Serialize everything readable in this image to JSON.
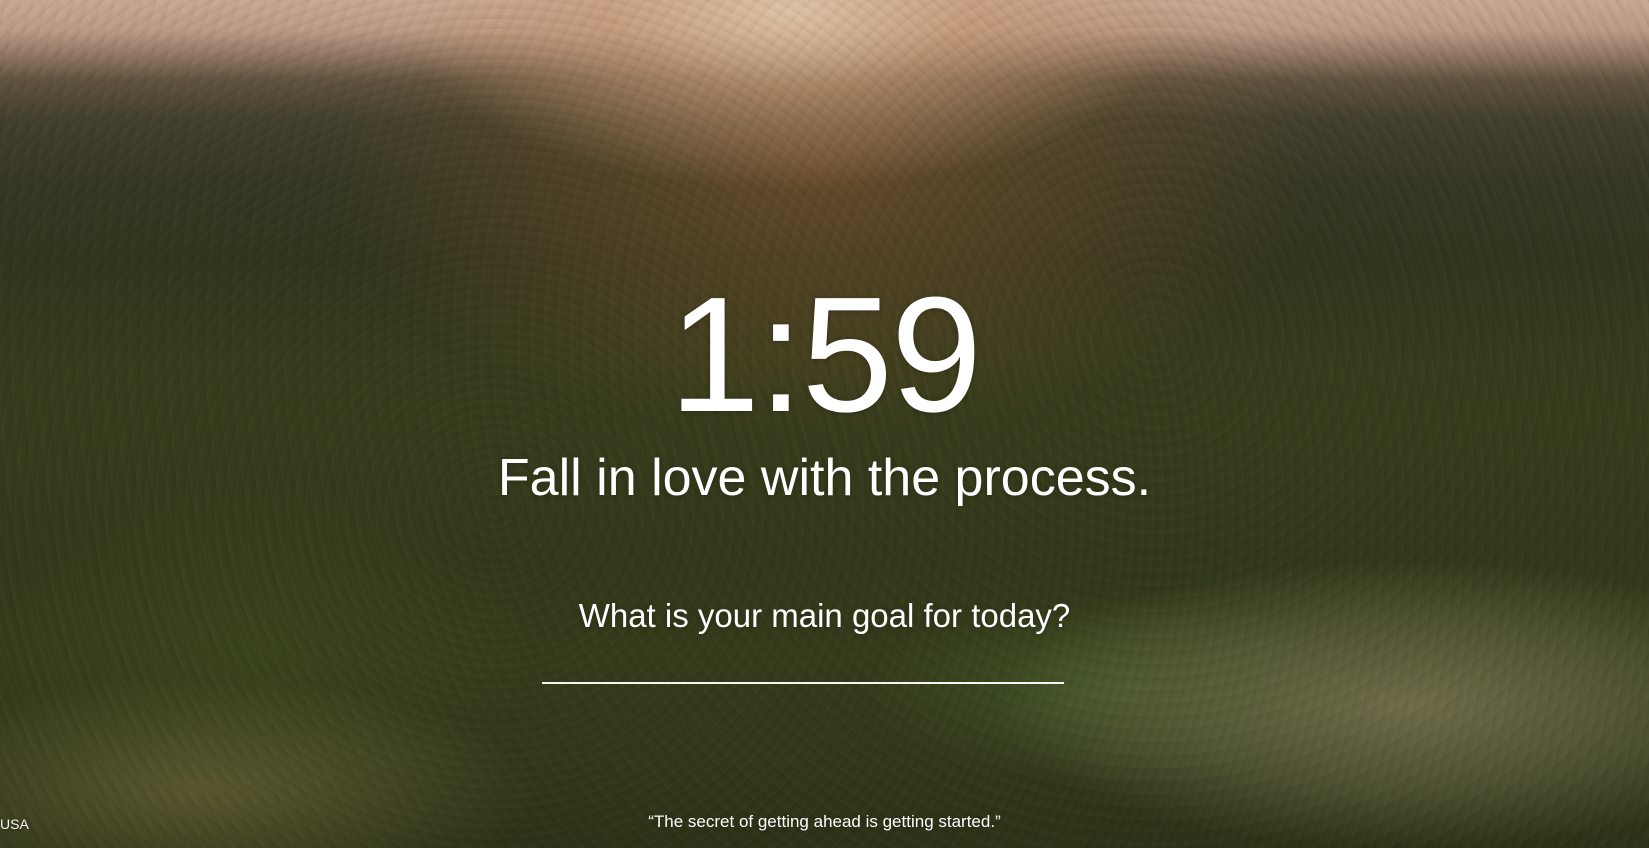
{
  "clock": {
    "time": "1:59"
  },
  "mantra": {
    "text": "Fall in love with the process."
  },
  "focus": {
    "prompt": "What is your main goal for today?",
    "value": "",
    "placeholder": ""
  },
  "footer": {
    "location": "USA",
    "quote": "“The secret of getting ahead is getting started.”"
  },
  "colors": {
    "text": "#ffffff",
    "sky_glow": "#e6c2aa",
    "forest": "#3d451f"
  }
}
